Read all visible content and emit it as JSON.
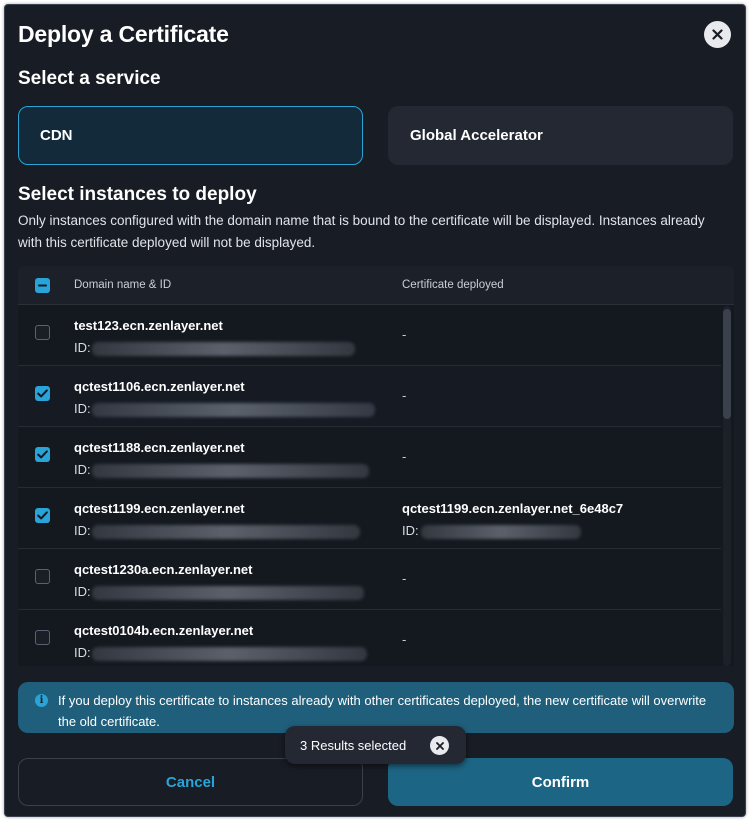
{
  "dialog": {
    "title": "Deploy a Certificate",
    "close_icon": "close-icon"
  },
  "service": {
    "heading": "Select a service",
    "options": [
      {
        "label": "CDN",
        "selected": true
      },
      {
        "label": "Global Accelerator",
        "selected": false
      }
    ]
  },
  "instances": {
    "heading": "Select instances to deploy",
    "description": "Only instances configured with the domain name that is bound to the certificate will be displayed. Instances already with this certificate deployed will not be displayed.",
    "columns": {
      "domain": "Domain name & ID",
      "cert": "Certificate deployed"
    },
    "id_label": "ID:",
    "rows": [
      {
        "domain": "test123.ecn.zenlayer.net",
        "checked": false,
        "cert": "-",
        "cert_id": ""
      },
      {
        "domain": "qctest1106.ecn.zenlayer.net",
        "checked": true,
        "cert": "-",
        "cert_id": ""
      },
      {
        "domain": "qctest1188.ecn.zenlayer.net",
        "checked": true,
        "cert": "-",
        "cert_id": ""
      },
      {
        "domain": "qctest1199.ecn.zenlayer.net",
        "checked": true,
        "cert": "qctest1199.ecn.zenlayer.net_6e48c7",
        "cert_id": "ID:"
      },
      {
        "domain": "qctest1230a.ecn.zenlayer.net",
        "checked": false,
        "cert": "-",
        "cert_id": ""
      },
      {
        "domain": "qctest0104b.ecn.zenlayer.net",
        "checked": false,
        "cert": "-",
        "cert_id": ""
      }
    ]
  },
  "notice": {
    "icon": "info-icon",
    "text": "If you deploy this certificate to instances already with other certificates deployed, the new certificate will overwrite the old certificate."
  },
  "toast": {
    "text": "3 Results selected"
  },
  "footer": {
    "cancel_label": "Cancel",
    "confirm_label": "Confirm"
  },
  "colors": {
    "accent": "#2aa4d6",
    "background": "#181c24",
    "confirm": "#1d6584",
    "notice": "#1f5f7c"
  }
}
